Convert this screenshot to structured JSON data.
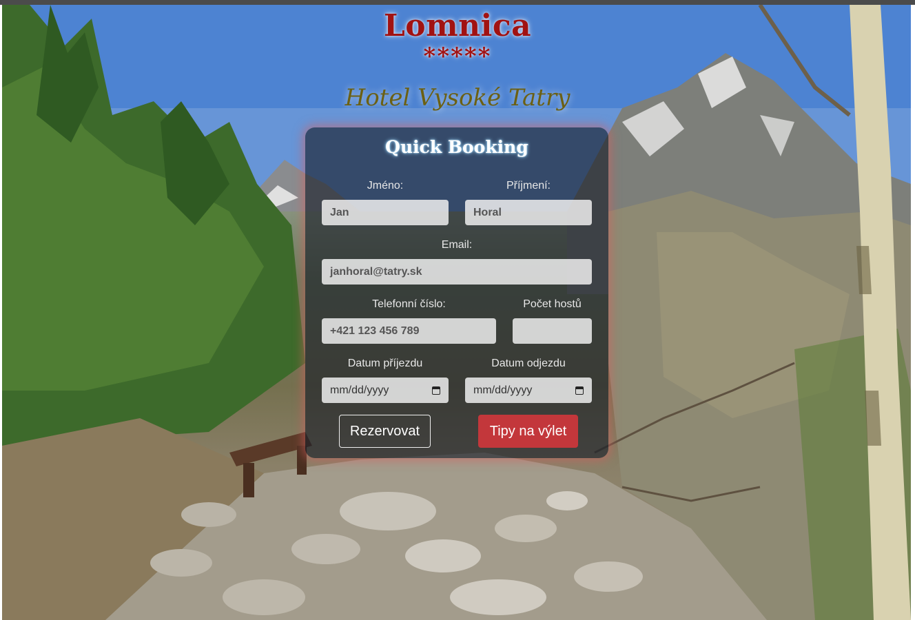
{
  "header": {
    "title": "Lomnica",
    "stars": "*****",
    "subtitle": "Hotel Vysoké Tatry"
  },
  "booking_form": {
    "title": "Quick Booking",
    "first_name": {
      "label": "Jméno:",
      "value": "Jan"
    },
    "last_name": {
      "label": "Příjmení:",
      "value": "Horal"
    },
    "email": {
      "label": "Email:",
      "value": "janhoral@tatry.sk"
    },
    "phone": {
      "label": "Telefonní číslo:",
      "value": "+421 123 456 789"
    },
    "guests": {
      "label": "Počet hostů",
      "value": ""
    },
    "arrival": {
      "label": "Datum příjezdu",
      "placeholder": "mm/dd/yyyy"
    },
    "departure": {
      "label": "Datum odjezdu",
      "placeholder": "mm/dd/yyyy"
    },
    "reserve_button": "Rezervovat",
    "trips_button": "Tipy na výlet"
  },
  "colors": {
    "brand_red": "#a11212",
    "subtitle_olive": "#6b6014",
    "button_red": "#c3373b"
  },
  "icons": {
    "date_picker": "calendar-icon"
  }
}
